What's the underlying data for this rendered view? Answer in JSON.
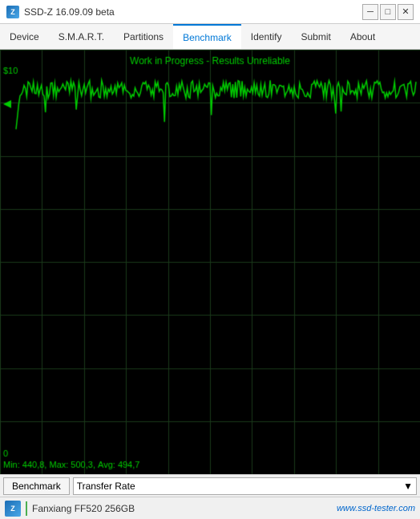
{
  "titleBar": {
    "title": "SSD-Z 16.09.09 beta",
    "iconText": "Z",
    "minimizeLabel": "─",
    "maximizeLabel": "□",
    "closeLabel": "✕"
  },
  "menuBar": {
    "items": [
      {
        "label": "Device",
        "active": false
      },
      {
        "label": "S.M.A.R.T.",
        "active": false
      },
      {
        "label": "Partitions",
        "active": false
      },
      {
        "label": "Benchmark",
        "active": true
      },
      {
        "label": "Identify",
        "active": false
      },
      {
        "label": "Submit",
        "active": false
      },
      {
        "label": "About",
        "active": false
      }
    ]
  },
  "chart": {
    "titleText": "Work in Progress - Results Unreliable",
    "yAxisTop": "$10",
    "yAxisBottom": "0",
    "statsText": "Min: 440,8, Max: 500,3, Avg: 494,7",
    "gridColor": "#1a3a1a",
    "lineColor": "#00cc00",
    "bgColor": "#000000"
  },
  "bottomBar": {
    "benchmarkButtonLabel": "Benchmark",
    "dropdownLabel": "Transfer Rate",
    "dropdownArrow": "▼"
  },
  "statusBar": {
    "deviceName": "Fanxiang FF520 256GB",
    "url": "www.ssd-tester.com"
  }
}
